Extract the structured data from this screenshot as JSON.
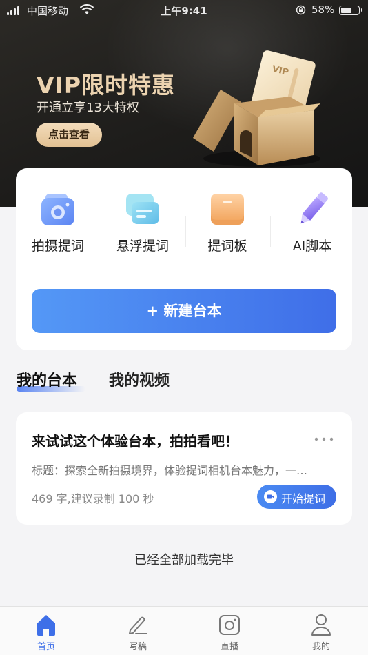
{
  "status_bar": {
    "carrier": "中国移动",
    "time": "上午9:41",
    "battery": "58%"
  },
  "banner": {
    "title": "VIP限时特惠",
    "subtitle": "开通立享13大特权",
    "button": "点击查看",
    "ticket_text": "VIP"
  },
  "tools": [
    {
      "label": "拍摄提词",
      "icon": "camera-icon"
    },
    {
      "label": "悬浮提词",
      "icon": "floating-window-icon"
    },
    {
      "label": "提词板",
      "icon": "board-icon"
    },
    {
      "label": "AI脚本",
      "icon": "pencil-icon"
    }
  ],
  "new_script_button": "+ 新建台本",
  "tabs": {
    "scripts": "我的台本",
    "videos": "我的视频"
  },
  "script": {
    "title": "来试试这个体验台本，拍拍看吧！",
    "description": "标题：探索全新拍摄境界，体验提词相机台本魅力，一…",
    "meta": "469 字,建议录制 100 秒",
    "start_button": "开始提词"
  },
  "end_message": "已经全部加载完毕",
  "bottom_nav": [
    {
      "label": "首页",
      "active": true
    },
    {
      "label": "写稿",
      "active": false
    },
    {
      "label": "直播",
      "active": false
    },
    {
      "label": "我的",
      "active": false
    }
  ],
  "colors": {
    "accent": "#3e6fe8",
    "vip_gold": "#ecd3b0",
    "banner_dark": "#1e1d1b"
  }
}
